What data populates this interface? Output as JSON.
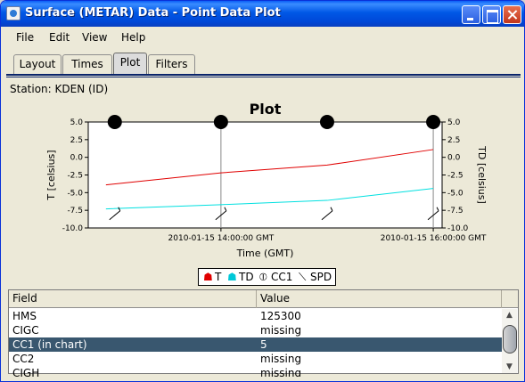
{
  "window": {
    "title": "Surface (METAR) Data - Point Data Plot",
    "controls": [
      "minimize",
      "maximize",
      "close"
    ]
  },
  "menu": {
    "items": [
      {
        "label": "File"
      },
      {
        "label": "Edit"
      },
      {
        "label": "View"
      },
      {
        "label": "Help"
      }
    ]
  },
  "tabs": [
    {
      "label": "Layout",
      "active": false
    },
    {
      "label": "Times",
      "active": false
    },
    {
      "label": "Plot",
      "active": true
    },
    {
      "label": "Filters",
      "active": false
    }
  ],
  "station": "Station: KDEN (ID)",
  "chart_data": {
    "type": "line",
    "title": "Plot",
    "xlabel": "Time (GMT)",
    "ylabel_left": "T [celsius]",
    "ylabel_right": "TD [celsius]",
    "ylim": [
      -10.0,
      5.0
    ],
    "y_ticks": [
      "5.0",
      "2.5",
      "0.0",
      "-2.5",
      "-5.0",
      "-7.5",
      "-10.0"
    ],
    "x_ticks": [
      "2010-01-15 14:00:00 GMT",
      "2010-01-15 16:00:00 GMT"
    ],
    "x_times": [
      "13:00",
      "14:00",
      "15:00",
      "16:00"
    ],
    "series": [
      {
        "name": "T",
        "color": "#e00000",
        "x": [
          "12:55",
          "14:00",
          "15:00",
          "16:00"
        ],
        "values": [
          -3.9,
          -2.2,
          -1.1,
          1.1
        ]
      },
      {
        "name": "TD",
        "color": "#00e0e0",
        "x": [
          "12:55",
          "14:00",
          "15:00",
          "16:00"
        ],
        "values": [
          -7.3,
          -6.7,
          -6.1,
          -4.4
        ]
      }
    ],
    "cc1": {
      "name": "CC1",
      "x": [
        "13:00",
        "14:00",
        "15:00",
        "16:00"
      ],
      "values": [
        5,
        5,
        5,
        5
      ]
    },
    "spd": {
      "name": "SPD",
      "x": [
        "13:00",
        "14:00",
        "15:00",
        "16:00"
      ]
    },
    "grid": true,
    "legend": {
      "placement": "bottom-center",
      "entries": [
        "T",
        "TD",
        "CC1",
        "SPD"
      ]
    }
  },
  "table": {
    "columns": [
      "Field",
      "Value"
    ],
    "rows": [
      {
        "field": "HMS",
        "value": "125300",
        "selected": false
      },
      {
        "field": "CIGC",
        "value": "missing",
        "selected": false
      },
      {
        "field": "CC1 (in chart)",
        "value": "5",
        "selected": true
      },
      {
        "field": "CC2",
        "value": "missing",
        "selected": false
      },
      {
        "field": "CIGH",
        "value": "missing",
        "selected": false
      }
    ]
  },
  "colors": {
    "title_bar": "#0058e6",
    "selected_row": "#39576f",
    "t_series": "#e00000",
    "td_series": "#00e0e0"
  }
}
